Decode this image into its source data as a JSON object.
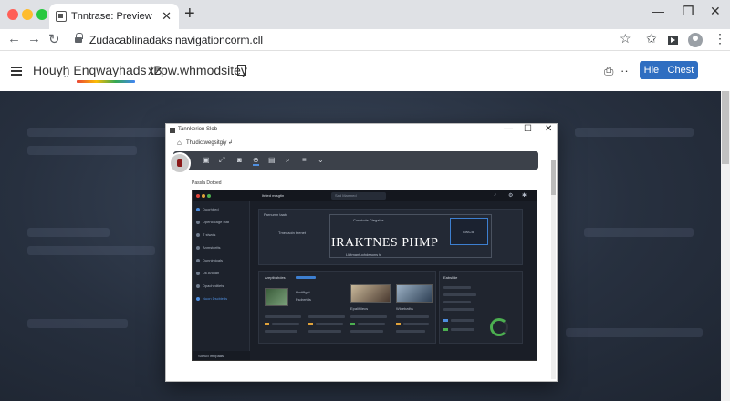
{
  "browser": {
    "tab_title": "Tnntrase: Preview",
    "tab_close": "✕",
    "new_tab": "+",
    "url": "Zudacablinadaks navigationcorm.cll",
    "icons": {
      "back": "arrow-left-icon",
      "forward": "arrow-right-icon",
      "reload": "reload-icon",
      "lock": "lock-icon",
      "bookmark": "star-icon",
      "extensions": "star-outline-icon",
      "media": "media-icon",
      "profile": "profile-icon",
      "menu": "kebab-menu-icon"
    },
    "window_controls": {
      "minimize": "—",
      "maximize": "❐",
      "close": "✕"
    }
  },
  "site": {
    "title": "Houyḫ Enqwayhads",
    "title_suffix": "tB",
    "subtitle": "xzpw.whmodsitey",
    "buttons": {
      "primary": "Hle",
      "secondary": "Chest"
    }
  },
  "modal": {
    "title": "Tannkerion Slob",
    "address": "Thudictwegsitgiy",
    "address_mark": "↲",
    "controls": {
      "minimize": "—",
      "maximize": "☐",
      "close": "✕"
    },
    "section_label": "Passla Dotbed",
    "dashboard": {
      "header_title": "Itrited mrsgtin",
      "search_placeholder": "Sad Maxmed",
      "nav_items": [
        "Duorhbed",
        "Dpeniocage ctat",
        "T stwcis",
        "Anmstcelts",
        "Dunnimioals",
        "Dk Anolan",
        "Dpachedtiets"
      ],
      "nav_active": "Nuon Dscbieds",
      "hero_label": "Parnumn taatd",
      "hero_heading": "Cosbicde Ctegalas",
      "hero_sub": "Tmedaoin tlrenet",
      "hero_title": "IRAKTNES PHMP",
      "hero_caption": "Lhltmantuohdeaons tr",
      "hero_card": "T3NCB",
      "panel_left_title": "Areptbahdes",
      "panel_right_title": "Eabslide",
      "thumb_labels": [
        "Hodfilgst",
        "Fsdnrrtds",
        "Epalihiiecs",
        "Wldebaths"
      ],
      "footer": "Sdeud Imppaas"
    }
  },
  "colors": {
    "accent": "#2f6ec1",
    "backdrop": "#27303f",
    "dashboard_bg": "#1a1e27",
    "active_tool": "#4f8fe0"
  }
}
